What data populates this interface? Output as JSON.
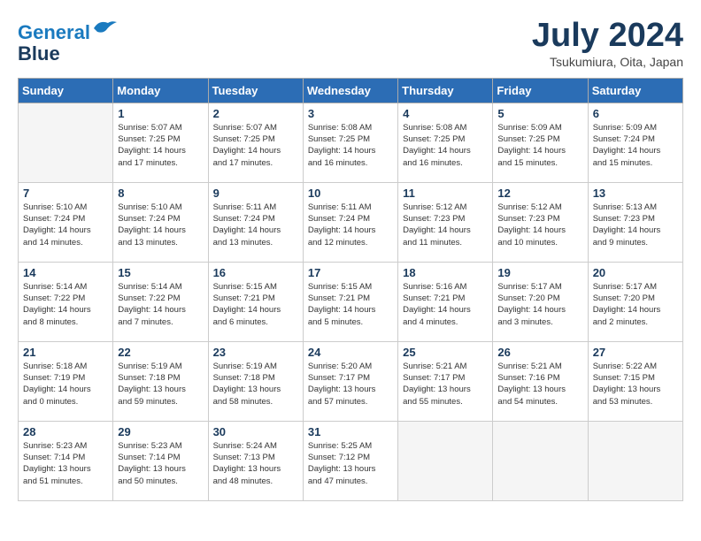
{
  "header": {
    "logo_line1": "General",
    "logo_line2": "Blue",
    "title": "July 2024",
    "subtitle": "Tsukumiura, Oita, Japan"
  },
  "weekdays": [
    "Sunday",
    "Monday",
    "Tuesday",
    "Wednesday",
    "Thursday",
    "Friday",
    "Saturday"
  ],
  "weeks": [
    [
      {
        "day": "",
        "info": ""
      },
      {
        "day": "1",
        "info": "Sunrise: 5:07 AM\nSunset: 7:25 PM\nDaylight: 14 hours\nand 17 minutes."
      },
      {
        "day": "2",
        "info": "Sunrise: 5:07 AM\nSunset: 7:25 PM\nDaylight: 14 hours\nand 17 minutes."
      },
      {
        "day": "3",
        "info": "Sunrise: 5:08 AM\nSunset: 7:25 PM\nDaylight: 14 hours\nand 16 minutes."
      },
      {
        "day": "4",
        "info": "Sunrise: 5:08 AM\nSunset: 7:25 PM\nDaylight: 14 hours\nand 16 minutes."
      },
      {
        "day": "5",
        "info": "Sunrise: 5:09 AM\nSunset: 7:25 PM\nDaylight: 14 hours\nand 15 minutes."
      },
      {
        "day": "6",
        "info": "Sunrise: 5:09 AM\nSunset: 7:24 PM\nDaylight: 14 hours\nand 15 minutes."
      }
    ],
    [
      {
        "day": "7",
        "info": "Sunrise: 5:10 AM\nSunset: 7:24 PM\nDaylight: 14 hours\nand 14 minutes."
      },
      {
        "day": "8",
        "info": "Sunrise: 5:10 AM\nSunset: 7:24 PM\nDaylight: 14 hours\nand 13 minutes."
      },
      {
        "day": "9",
        "info": "Sunrise: 5:11 AM\nSunset: 7:24 PM\nDaylight: 14 hours\nand 13 minutes."
      },
      {
        "day": "10",
        "info": "Sunrise: 5:11 AM\nSunset: 7:24 PM\nDaylight: 14 hours\nand 12 minutes."
      },
      {
        "day": "11",
        "info": "Sunrise: 5:12 AM\nSunset: 7:23 PM\nDaylight: 14 hours\nand 11 minutes."
      },
      {
        "day": "12",
        "info": "Sunrise: 5:12 AM\nSunset: 7:23 PM\nDaylight: 14 hours\nand 10 minutes."
      },
      {
        "day": "13",
        "info": "Sunrise: 5:13 AM\nSunset: 7:23 PM\nDaylight: 14 hours\nand 9 minutes."
      }
    ],
    [
      {
        "day": "14",
        "info": "Sunrise: 5:14 AM\nSunset: 7:22 PM\nDaylight: 14 hours\nand 8 minutes."
      },
      {
        "day": "15",
        "info": "Sunrise: 5:14 AM\nSunset: 7:22 PM\nDaylight: 14 hours\nand 7 minutes."
      },
      {
        "day": "16",
        "info": "Sunrise: 5:15 AM\nSunset: 7:21 PM\nDaylight: 14 hours\nand 6 minutes."
      },
      {
        "day": "17",
        "info": "Sunrise: 5:15 AM\nSunset: 7:21 PM\nDaylight: 14 hours\nand 5 minutes."
      },
      {
        "day": "18",
        "info": "Sunrise: 5:16 AM\nSunset: 7:21 PM\nDaylight: 14 hours\nand 4 minutes."
      },
      {
        "day": "19",
        "info": "Sunrise: 5:17 AM\nSunset: 7:20 PM\nDaylight: 14 hours\nand 3 minutes."
      },
      {
        "day": "20",
        "info": "Sunrise: 5:17 AM\nSunset: 7:20 PM\nDaylight: 14 hours\nand 2 minutes."
      }
    ],
    [
      {
        "day": "21",
        "info": "Sunrise: 5:18 AM\nSunset: 7:19 PM\nDaylight: 14 hours\nand 0 minutes."
      },
      {
        "day": "22",
        "info": "Sunrise: 5:19 AM\nSunset: 7:18 PM\nDaylight: 13 hours\nand 59 minutes."
      },
      {
        "day": "23",
        "info": "Sunrise: 5:19 AM\nSunset: 7:18 PM\nDaylight: 13 hours\nand 58 minutes."
      },
      {
        "day": "24",
        "info": "Sunrise: 5:20 AM\nSunset: 7:17 PM\nDaylight: 13 hours\nand 57 minutes."
      },
      {
        "day": "25",
        "info": "Sunrise: 5:21 AM\nSunset: 7:17 PM\nDaylight: 13 hours\nand 55 minutes."
      },
      {
        "day": "26",
        "info": "Sunrise: 5:21 AM\nSunset: 7:16 PM\nDaylight: 13 hours\nand 54 minutes."
      },
      {
        "day": "27",
        "info": "Sunrise: 5:22 AM\nSunset: 7:15 PM\nDaylight: 13 hours\nand 53 minutes."
      }
    ],
    [
      {
        "day": "28",
        "info": "Sunrise: 5:23 AM\nSunset: 7:14 PM\nDaylight: 13 hours\nand 51 minutes."
      },
      {
        "day": "29",
        "info": "Sunrise: 5:23 AM\nSunset: 7:14 PM\nDaylight: 13 hours\nand 50 minutes."
      },
      {
        "day": "30",
        "info": "Sunrise: 5:24 AM\nSunset: 7:13 PM\nDaylight: 13 hours\nand 48 minutes."
      },
      {
        "day": "31",
        "info": "Sunrise: 5:25 AM\nSunset: 7:12 PM\nDaylight: 13 hours\nand 47 minutes."
      },
      {
        "day": "",
        "info": ""
      },
      {
        "day": "",
        "info": ""
      },
      {
        "day": "",
        "info": ""
      }
    ]
  ]
}
